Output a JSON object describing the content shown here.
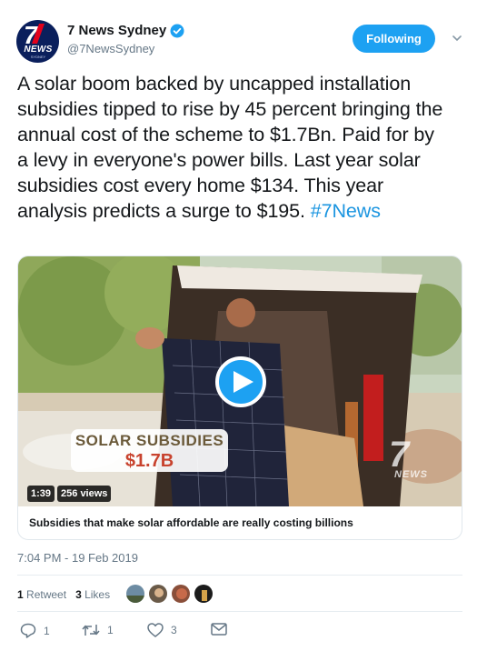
{
  "account": {
    "display_name": "7 News Sydney",
    "handle": "@7NewsSydney",
    "avatar_text": "NEWS",
    "avatar_sub": "SYDNEY",
    "verified": true
  },
  "follow_button": {
    "label": "Following"
  },
  "tweet": {
    "text": "A solar boom backed by uncapped installation subsidies tipped to rise by 45 percent bringing the annual cost of the scheme to $1.7Bn. Paid for by a levy in everyone's power bills. Last year solar subsidies cost every home $134. This year analysis predicts a surge to $195.",
    "hashtag": "#7News",
    "timestamp": "7:04 PM - 19 Feb 2019"
  },
  "media": {
    "banner_line1": "SOLAR SUBSIDIES",
    "banner_line2": "$1.7B",
    "duration": "1:39",
    "views": "256 views",
    "logo_seven": "7",
    "logo_news": "NEWS",
    "caption": "Subsidies that make solar affordable are really costing billions"
  },
  "engagement": {
    "retweets_count": "1",
    "retweets_label": "Retweet",
    "likes_count": "3",
    "likes_label": "Likes"
  },
  "actions": {
    "reply_count": "1",
    "retweet_count": "1",
    "like_count": "3"
  },
  "colors": {
    "accent": "#1da1f2",
    "hashtag": "#1b95e0",
    "muted": "#657786"
  }
}
